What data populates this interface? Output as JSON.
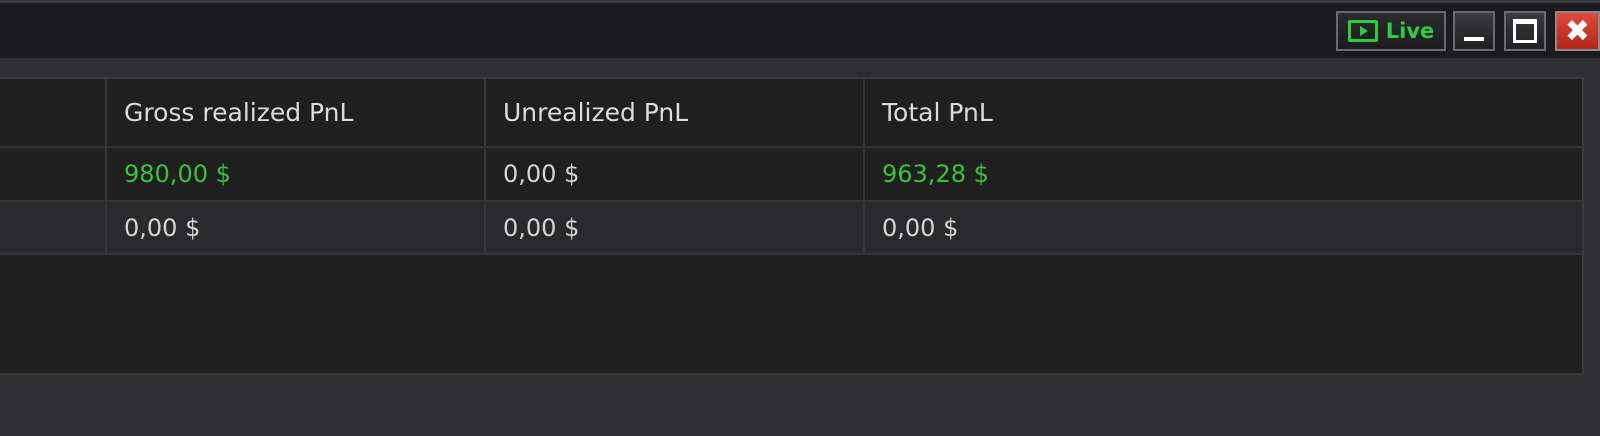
{
  "title_bar": {
    "live_label": "Live",
    "icons": {
      "live": "play-screen-icon",
      "minimize": "minimize-icon",
      "maximize": "maximize-icon",
      "close": "close-icon"
    },
    "close_glyph": "✖"
  },
  "table": {
    "columns": [
      "Gross realized PnL",
      "Unrealized PnL",
      "Total PnL"
    ],
    "rows": [
      {
        "gross_realized": "980,00 $",
        "unrealized": "0,00 $",
        "total": "963,28 $"
      },
      {
        "gross_realized": "0,00 $",
        "unrealized": "0,00 $",
        "total": "0,00 $"
      }
    ]
  },
  "colors": {
    "positive": "#3cc13c",
    "live_green": "#2ecc40",
    "close_red": "#c8301f",
    "background": "#1f1f20"
  }
}
